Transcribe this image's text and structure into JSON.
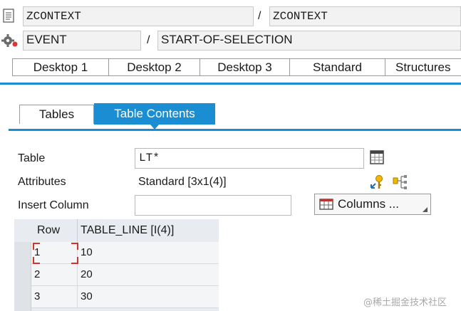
{
  "program": {
    "name": "ZCONTEXT",
    "separator": "/",
    "main_program": "ZCONTEXT"
  },
  "event": {
    "name": "EVENT",
    "separator": "/",
    "value": "START-OF-SELECTION"
  },
  "desktop_tabs": [
    "Desktop 1",
    "Desktop 2",
    "Desktop 3",
    "Standard",
    "Structures"
  ],
  "view_tabs": [
    {
      "label": "Tables",
      "active": false
    },
    {
      "label": "Table Contents",
      "active": true
    }
  ],
  "form": {
    "table_label": "Table",
    "table_value": "LT*",
    "attributes_label": "Attributes",
    "attributes_value": "Standard [3x1(4)]",
    "insert_column_label": "Insert Column",
    "insert_column_value": "",
    "columns_button": "Columns ..."
  },
  "grid": {
    "headers": [
      "Row",
      "TABLE_LINE [I(4)]"
    ],
    "rows": [
      [
        "1",
        "10"
      ],
      [
        "2",
        "20"
      ],
      [
        "3",
        "30"
      ]
    ]
  },
  "watermark": "@稀土掘金技术社区",
  "colors": {
    "accent": "#1b8ed3",
    "active_tab": "#1b8ed3"
  }
}
